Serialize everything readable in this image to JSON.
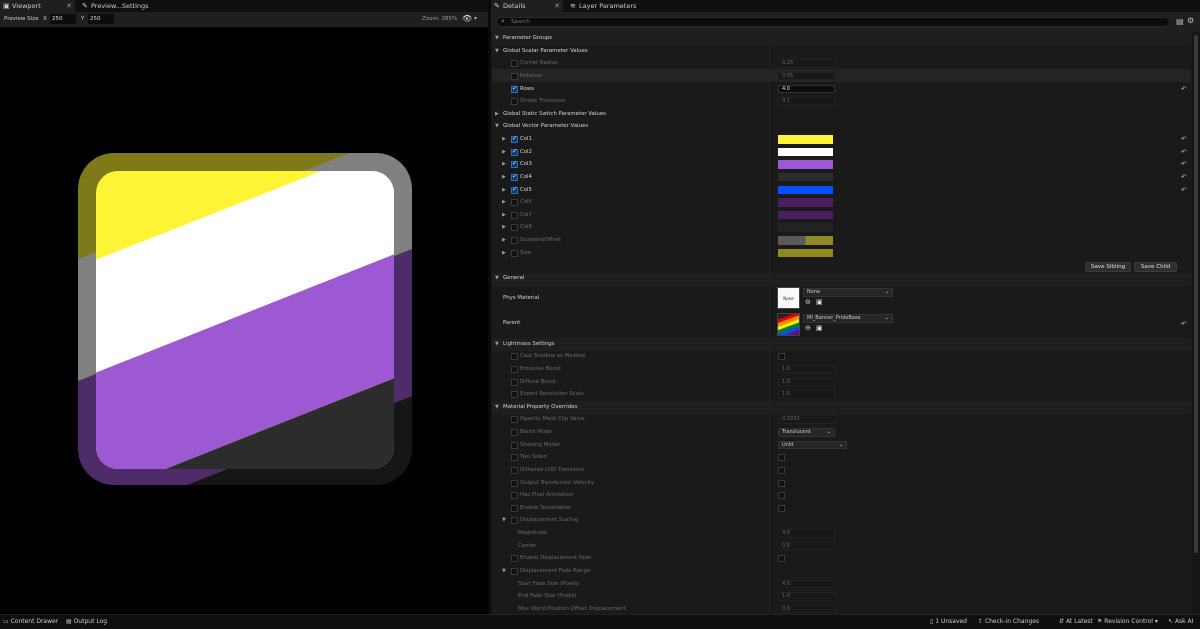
{
  "viewport": {
    "tab_label": "Viewport",
    "preview_tab_label": "Preview...Settings",
    "preview_size_label": "Preview Size",
    "x_label": "X",
    "x_value": "250",
    "y_label": "Y",
    "y_value": "250",
    "zoom": "Zoom: 285%",
    "flag_colors": [
      "#fcf434",
      "#ffffff",
      "#9c59d1",
      "#2c2c2c"
    ]
  },
  "details": {
    "tab_label": "Details",
    "layer_tab_label": "Layer Parameters",
    "search_placeholder": "Search",
    "parameter_groups": "Parameter Groups",
    "scalar_group": "Global Scalar Parameter Values",
    "scalars": [
      {
        "name": "Corner Radius",
        "value": "0.25",
        "checked": false
      },
      {
        "name": "Rotation",
        "value": "0.05",
        "checked": false
      },
      {
        "name": "Rows",
        "value": "4.0",
        "checked": true
      },
      {
        "name": "Stroke Thickness",
        "value": "0.1",
        "checked": false
      }
    ],
    "static_switch_group": "Global Static Switch Parameter Values",
    "vector_group": "Global Vector Parameter Values",
    "vectors": [
      {
        "name": "Col1",
        "color": "#fcf434",
        "checked": true
      },
      {
        "name": "Col2",
        "color": "#ffffff",
        "checked": true
      },
      {
        "name": "Col3",
        "color": "#9c59d1",
        "checked": true
      },
      {
        "name": "Col4",
        "color": "#2c2c2c",
        "checked": true
      },
      {
        "name": "Col5",
        "color": "#0a4fff",
        "checked": true
      },
      {
        "name": "Col6",
        "color": "#4a1f5e",
        "checked": false
      },
      {
        "name": "Col7",
        "color": "#4a1f5e",
        "checked": false
      },
      {
        "name": "Col8",
        "color": "#222222",
        "checked": false
      },
      {
        "name": "ScaleandOffset",
        "color": "#8f8a2a",
        "checked": false
      },
      {
        "name": "Size",
        "color": "#8f8a1f",
        "checked": false
      }
    ],
    "save_sibling": "Save Sibling",
    "save_child": "Save Child",
    "general": "General",
    "phys_material_label": "Phys Material",
    "phys_material_thumb": "None",
    "phys_material_value": "None",
    "parent_label": "Parent",
    "parent_value": "MI_Banner_PrideBase",
    "lightmass": "Lightmass Settings",
    "lightmass_items": [
      {
        "name": "Cast Shadow as Masked",
        "value": ""
      },
      {
        "name": "Emissive Boost",
        "value": "1.0"
      },
      {
        "name": "Diffuse Boost",
        "value": "1.0"
      },
      {
        "name": "Export Resolution Scale",
        "value": "1.0"
      }
    ],
    "overrides": "Material Property Overrides",
    "override_items": [
      {
        "name": "Opacity Mask Clip Value",
        "value": "0.3333"
      },
      {
        "name": "Blend Mode",
        "value": "Translucent"
      },
      {
        "name": "Shading Model",
        "value": "Unlit"
      },
      {
        "name": "Two Sided",
        "value": ""
      },
      {
        "name": "Dithered LOD Transition",
        "value": ""
      },
      {
        "name": "Output Translucent Velocity",
        "value": ""
      },
      {
        "name": "Has Pixel Animation",
        "value": ""
      },
      {
        "name": "Enable Tessellation",
        "value": ""
      },
      {
        "name": "Displacement Scaling",
        "value": ""
      },
      {
        "name": "Magnitude",
        "value": "4.0"
      },
      {
        "name": "Center",
        "value": "0.5"
      },
      {
        "name": "Enable Displacement Fade",
        "value": ""
      },
      {
        "name": "Displacement Fade Range",
        "value": ""
      },
      {
        "name": "Start Fade Size (Pixels)",
        "value": "4.0"
      },
      {
        "name": "End Fade Size (Pixels)",
        "value": "1.0"
      },
      {
        "name": "Max World Position Offset Displacement",
        "value": "0.0"
      }
    ]
  },
  "statusbar": {
    "content_drawer": "Content Drawer",
    "output_log": "Output Log",
    "unsaved": "1 Unsaved",
    "checkin": "Check-in Changes",
    "at_latest": "At Latest",
    "revision": "Revision Control",
    "ask_ai": "Ask AI"
  }
}
